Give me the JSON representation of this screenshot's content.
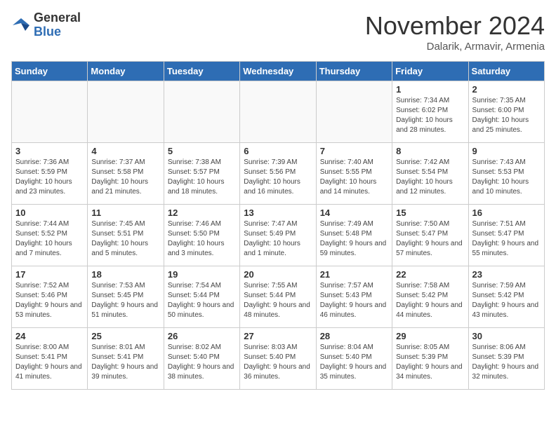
{
  "header": {
    "logo": {
      "line1": "General",
      "line2": "Blue"
    },
    "title": "November 2024",
    "location": "Dalarik, Armavir, Armenia"
  },
  "calendar": {
    "weekdays": [
      "Sunday",
      "Monday",
      "Tuesday",
      "Wednesday",
      "Thursday",
      "Friday",
      "Saturday"
    ],
    "weeks": [
      [
        {
          "day": "",
          "info": ""
        },
        {
          "day": "",
          "info": ""
        },
        {
          "day": "",
          "info": ""
        },
        {
          "day": "",
          "info": ""
        },
        {
          "day": "",
          "info": ""
        },
        {
          "day": "1",
          "info": "Sunrise: 7:34 AM\nSunset: 6:02 PM\nDaylight: 10 hours and 28 minutes."
        },
        {
          "day": "2",
          "info": "Sunrise: 7:35 AM\nSunset: 6:00 PM\nDaylight: 10 hours and 25 minutes."
        }
      ],
      [
        {
          "day": "3",
          "info": "Sunrise: 7:36 AM\nSunset: 5:59 PM\nDaylight: 10 hours and 23 minutes."
        },
        {
          "day": "4",
          "info": "Sunrise: 7:37 AM\nSunset: 5:58 PM\nDaylight: 10 hours and 21 minutes."
        },
        {
          "day": "5",
          "info": "Sunrise: 7:38 AM\nSunset: 5:57 PM\nDaylight: 10 hours and 18 minutes."
        },
        {
          "day": "6",
          "info": "Sunrise: 7:39 AM\nSunset: 5:56 PM\nDaylight: 10 hours and 16 minutes."
        },
        {
          "day": "7",
          "info": "Sunrise: 7:40 AM\nSunset: 5:55 PM\nDaylight: 10 hours and 14 minutes."
        },
        {
          "day": "8",
          "info": "Sunrise: 7:42 AM\nSunset: 5:54 PM\nDaylight: 10 hours and 12 minutes."
        },
        {
          "day": "9",
          "info": "Sunrise: 7:43 AM\nSunset: 5:53 PM\nDaylight: 10 hours and 10 minutes."
        }
      ],
      [
        {
          "day": "10",
          "info": "Sunrise: 7:44 AM\nSunset: 5:52 PM\nDaylight: 10 hours and 7 minutes."
        },
        {
          "day": "11",
          "info": "Sunrise: 7:45 AM\nSunset: 5:51 PM\nDaylight: 10 hours and 5 minutes."
        },
        {
          "day": "12",
          "info": "Sunrise: 7:46 AM\nSunset: 5:50 PM\nDaylight: 10 hours and 3 minutes."
        },
        {
          "day": "13",
          "info": "Sunrise: 7:47 AM\nSunset: 5:49 PM\nDaylight: 10 hours and 1 minute."
        },
        {
          "day": "14",
          "info": "Sunrise: 7:49 AM\nSunset: 5:48 PM\nDaylight: 9 hours and 59 minutes."
        },
        {
          "day": "15",
          "info": "Sunrise: 7:50 AM\nSunset: 5:47 PM\nDaylight: 9 hours and 57 minutes."
        },
        {
          "day": "16",
          "info": "Sunrise: 7:51 AM\nSunset: 5:47 PM\nDaylight: 9 hours and 55 minutes."
        }
      ],
      [
        {
          "day": "17",
          "info": "Sunrise: 7:52 AM\nSunset: 5:46 PM\nDaylight: 9 hours and 53 minutes."
        },
        {
          "day": "18",
          "info": "Sunrise: 7:53 AM\nSunset: 5:45 PM\nDaylight: 9 hours and 51 minutes."
        },
        {
          "day": "19",
          "info": "Sunrise: 7:54 AM\nSunset: 5:44 PM\nDaylight: 9 hours and 50 minutes."
        },
        {
          "day": "20",
          "info": "Sunrise: 7:55 AM\nSunset: 5:44 PM\nDaylight: 9 hours and 48 minutes."
        },
        {
          "day": "21",
          "info": "Sunrise: 7:57 AM\nSunset: 5:43 PM\nDaylight: 9 hours and 46 minutes."
        },
        {
          "day": "22",
          "info": "Sunrise: 7:58 AM\nSunset: 5:42 PM\nDaylight: 9 hours and 44 minutes."
        },
        {
          "day": "23",
          "info": "Sunrise: 7:59 AM\nSunset: 5:42 PM\nDaylight: 9 hours and 43 minutes."
        }
      ],
      [
        {
          "day": "24",
          "info": "Sunrise: 8:00 AM\nSunset: 5:41 PM\nDaylight: 9 hours and 41 minutes."
        },
        {
          "day": "25",
          "info": "Sunrise: 8:01 AM\nSunset: 5:41 PM\nDaylight: 9 hours and 39 minutes."
        },
        {
          "day": "26",
          "info": "Sunrise: 8:02 AM\nSunset: 5:40 PM\nDaylight: 9 hours and 38 minutes."
        },
        {
          "day": "27",
          "info": "Sunrise: 8:03 AM\nSunset: 5:40 PM\nDaylight: 9 hours and 36 minutes."
        },
        {
          "day": "28",
          "info": "Sunrise: 8:04 AM\nSunset: 5:40 PM\nDaylight: 9 hours and 35 minutes."
        },
        {
          "day": "29",
          "info": "Sunrise: 8:05 AM\nSunset: 5:39 PM\nDaylight: 9 hours and 34 minutes."
        },
        {
          "day": "30",
          "info": "Sunrise: 8:06 AM\nSunset: 5:39 PM\nDaylight: 9 hours and 32 minutes."
        }
      ]
    ]
  }
}
